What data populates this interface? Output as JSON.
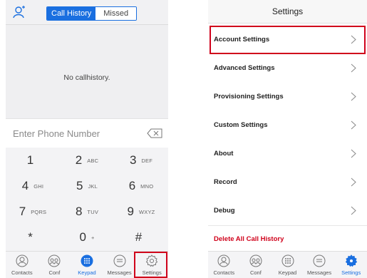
{
  "left": {
    "tabs": {
      "history": "Call History",
      "missed": "Missed"
    },
    "empty_text": "No callhistory.",
    "phone_input_placeholder": "Enter Phone Number",
    "keys": [
      {
        "digit": "1",
        "letters": ""
      },
      {
        "digit": "2",
        "letters": "ABC"
      },
      {
        "digit": "3",
        "letters": "DEF"
      },
      {
        "digit": "4",
        "letters": "GHI"
      },
      {
        "digit": "5",
        "letters": "JKL"
      },
      {
        "digit": "6",
        "letters": "MNO"
      },
      {
        "digit": "7",
        "letters": "PQRS"
      },
      {
        "digit": "8",
        "letters": "TUV"
      },
      {
        "digit": "9",
        "letters": "WXYZ"
      },
      {
        "digit": "*",
        "letters": ""
      },
      {
        "digit": "0",
        "letters": "+"
      },
      {
        "digit": "#",
        "letters": ""
      }
    ],
    "tabbar": [
      {
        "label": "Contacts"
      },
      {
        "label": "Conf"
      },
      {
        "label": "Keypad"
      },
      {
        "label": "Messages"
      },
      {
        "label": "Settings"
      }
    ],
    "active_tab": "Keypad"
  },
  "right": {
    "title": "Settings",
    "items": [
      {
        "label": "Account Settings"
      },
      {
        "label": "Advanced Settings"
      },
      {
        "label": "Provisioning Settings"
      },
      {
        "label": "Custom Settings"
      },
      {
        "label": "About"
      },
      {
        "label": "Record"
      },
      {
        "label": "Debug"
      }
    ],
    "delete_label": "Delete All Call History",
    "tabbar": [
      {
        "label": "Contacts"
      },
      {
        "label": "Conf"
      },
      {
        "label": "Keypad"
      },
      {
        "label": "Messages"
      },
      {
        "label": "Settings"
      }
    ],
    "active_tab": "Settings"
  },
  "colors": {
    "accent": "#1a6fe0",
    "highlight": "#d0021b",
    "danger": "#d0021b"
  }
}
